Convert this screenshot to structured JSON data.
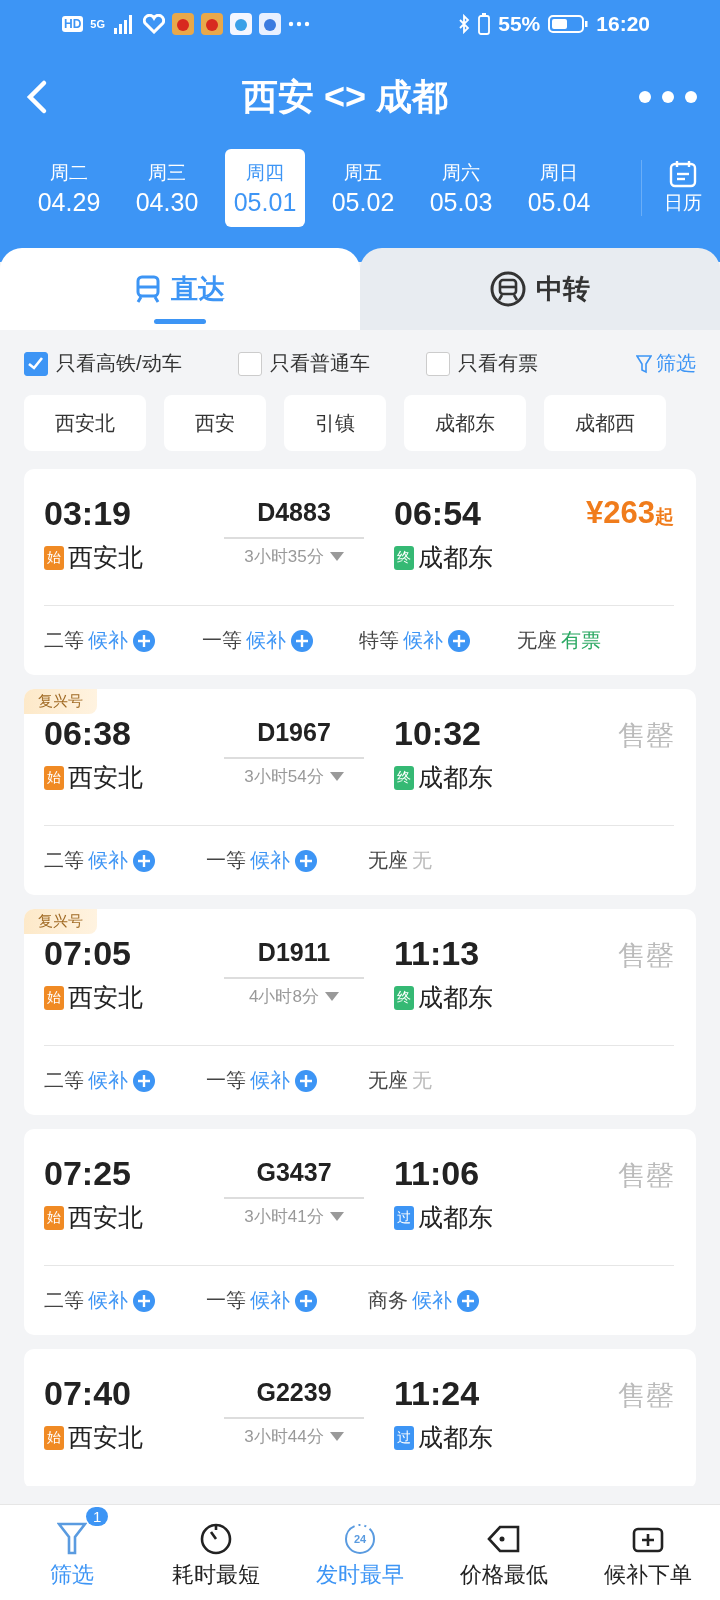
{
  "status_bar": {
    "network": [
      "HD",
      "5G"
    ],
    "battery": "55%",
    "time": "16:20"
  },
  "title_bar": {
    "title": "西安 <> 成都"
  },
  "dates": [
    {
      "weekday": "周二",
      "date": "04.29",
      "selected": false
    },
    {
      "weekday": "周三",
      "date": "04.30",
      "selected": false
    },
    {
      "weekday": "周四",
      "date": "05.01",
      "selected": true
    },
    {
      "weekday": "周五",
      "date": "05.02",
      "selected": false
    },
    {
      "weekday": "周六",
      "date": "05.03",
      "selected": false
    },
    {
      "weekday": "周日",
      "date": "05.04",
      "selected": false
    }
  ],
  "calendar_button": "日历",
  "tabs": [
    {
      "label": "直达",
      "kind": "direct",
      "selected": true
    },
    {
      "label": "中转",
      "kind": "transfer",
      "selected": false
    }
  ],
  "filters": [
    {
      "label": "只看高铁/动车",
      "checked": true
    },
    {
      "label": "只看普通车",
      "checked": false
    },
    {
      "label": "只看有票",
      "checked": false
    }
  ],
  "filter_link": "筛选",
  "stations": [
    "西安北",
    "西安",
    "引镇",
    "成都东",
    "成都西"
  ],
  "trains": [
    {
      "depart": "03:19",
      "number": "D4883",
      "duration": "3小时35分",
      "arrive": "06:54",
      "from": {
        "tag": "始",
        "kind": "start",
        "name": "西安北"
      },
      "to": {
        "tag": "终",
        "kind": "end",
        "name": "成都东"
      },
      "price": "¥263",
      "price_suffix": "起",
      "seats": [
        {
          "cls": "二等",
          "status": "候补",
          "kind": "waitlist"
        },
        {
          "cls": "一等",
          "status": "候补",
          "kind": "waitlist"
        },
        {
          "cls": "特等",
          "status": "候补",
          "kind": "waitlist"
        },
        {
          "cls": "无座",
          "status": "有票",
          "kind": "available"
        }
      ]
    },
    {
      "badge": "复兴号",
      "depart": "06:38",
      "number": "D1967",
      "duration": "3小时54分",
      "arrive": "10:32",
      "from": {
        "tag": "始",
        "kind": "start",
        "name": "西安北"
      },
      "to": {
        "tag": "终",
        "kind": "end",
        "name": "成都东"
      },
      "sold_out": "售罄",
      "seats": [
        {
          "cls": "二等",
          "status": "候补",
          "kind": "waitlist"
        },
        {
          "cls": "一等",
          "status": "候补",
          "kind": "waitlist"
        },
        {
          "cls": "无座",
          "status": "无",
          "kind": "none"
        }
      ]
    },
    {
      "badge": "复兴号",
      "depart": "07:05",
      "number": "D1911",
      "duration": "4小时8分",
      "arrive": "11:13",
      "from": {
        "tag": "始",
        "kind": "start",
        "name": "西安北"
      },
      "to": {
        "tag": "终",
        "kind": "end",
        "name": "成都东"
      },
      "sold_out": "售罄",
      "seats": [
        {
          "cls": "二等",
          "status": "候补",
          "kind": "waitlist"
        },
        {
          "cls": "一等",
          "status": "候补",
          "kind": "waitlist"
        },
        {
          "cls": "无座",
          "status": "无",
          "kind": "none"
        }
      ]
    },
    {
      "depart": "07:25",
      "number": "G3437",
      "duration": "3小时41分",
      "arrive": "11:06",
      "from": {
        "tag": "始",
        "kind": "start",
        "name": "西安北"
      },
      "to": {
        "tag": "过",
        "kind": "pass",
        "name": "成都东"
      },
      "sold_out": "售罄",
      "seats": [
        {
          "cls": "二等",
          "status": "候补",
          "kind": "waitlist"
        },
        {
          "cls": "一等",
          "status": "候补",
          "kind": "waitlist"
        },
        {
          "cls": "商务",
          "status": "候补",
          "kind": "waitlist"
        }
      ]
    },
    {
      "depart": "07:40",
      "number": "G2239",
      "duration": "3小时44分",
      "arrive": "11:24",
      "from": {
        "tag": "始",
        "kind": "start",
        "name": "西安北"
      },
      "to": {
        "tag": "过",
        "kind": "pass",
        "name": "成都东"
      },
      "sold_out": "售罄"
    }
  ],
  "bottom_bar": [
    {
      "label": "筛选",
      "kind": "filter",
      "selected": true,
      "count": "1"
    },
    {
      "label": "耗时最短",
      "kind": "timer",
      "selected": false
    },
    {
      "label": "发时最早",
      "kind": "clock24",
      "selected": true,
      "icon_text": "24"
    },
    {
      "label": "价格最低",
      "kind": "tag",
      "selected": false
    },
    {
      "label": "候补下单",
      "kind": "waitlist",
      "selected": false
    }
  ]
}
